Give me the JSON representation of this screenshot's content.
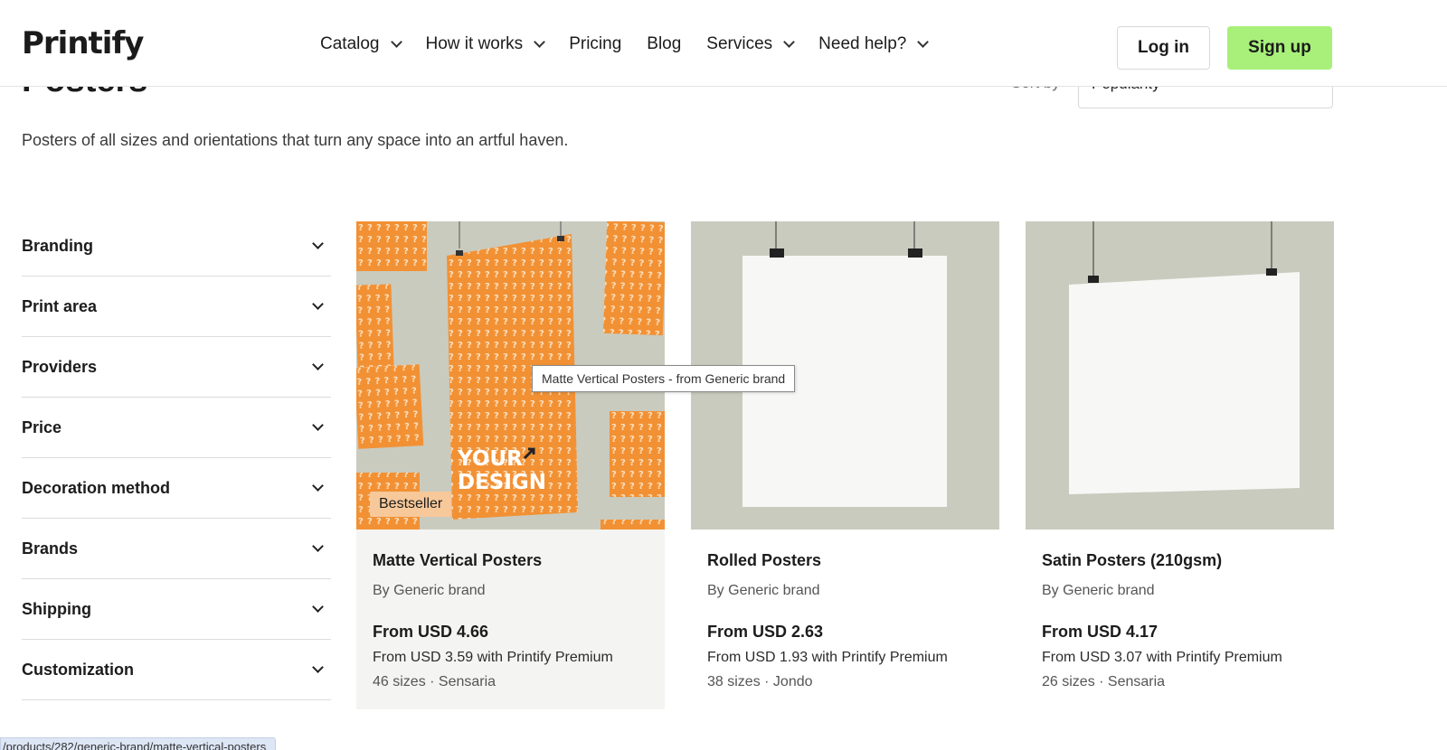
{
  "brand": {
    "logo": "Printify"
  },
  "nav": {
    "items": [
      {
        "label": "Catalog",
        "dropdown": true
      },
      {
        "label": "How it works",
        "dropdown": true
      },
      {
        "label": "Pricing",
        "dropdown": false
      },
      {
        "label": "Blog",
        "dropdown": false
      },
      {
        "label": "Services",
        "dropdown": true
      },
      {
        "label": "Need help?",
        "dropdown": true
      }
    ],
    "login": "Log in",
    "signup": "Sign up"
  },
  "page": {
    "title": "Posters",
    "subtitle": "Posters of all sizes and orientations that turn any space into an artful haven.",
    "sort_label": "Sort by",
    "sort_value": "Popularity"
  },
  "filters": [
    "Branding",
    "Print area",
    "Providers",
    "Price",
    "Decoration method",
    "Brands",
    "Shipping",
    "Customization"
  ],
  "products": [
    {
      "name": "Matte Vertical Posters",
      "brand": "By Generic brand",
      "price": "From USD 4.66",
      "premium": "From USD 3.59 with Printify Premium",
      "sizes": "46 sizes · Sensaria",
      "badge": "Bestseller",
      "image_text": "YOUR DESIGN"
    },
    {
      "name": "Rolled Posters",
      "brand": "By Generic brand",
      "price": "From USD 2.63",
      "premium": "From USD 1.93 with Printify Premium",
      "sizes": "38 sizes · Jondo"
    },
    {
      "name": "Satin Posters (210gsm)",
      "brand": "By Generic brand",
      "price": "From USD 4.17",
      "premium": "From USD 3.07 with Printify Premium",
      "sizes": "26 sizes · Sensaria"
    }
  ],
  "tooltip": "Matte Vertical Posters - from Generic brand",
  "status_url": "/products/282/generic-brand/matte-vertical-posters",
  "colors": {
    "accent_signup": "#a8f07a",
    "badge": "#f7c89a",
    "poster_orange": "#f29134",
    "wall": "#c9cbbf"
  }
}
